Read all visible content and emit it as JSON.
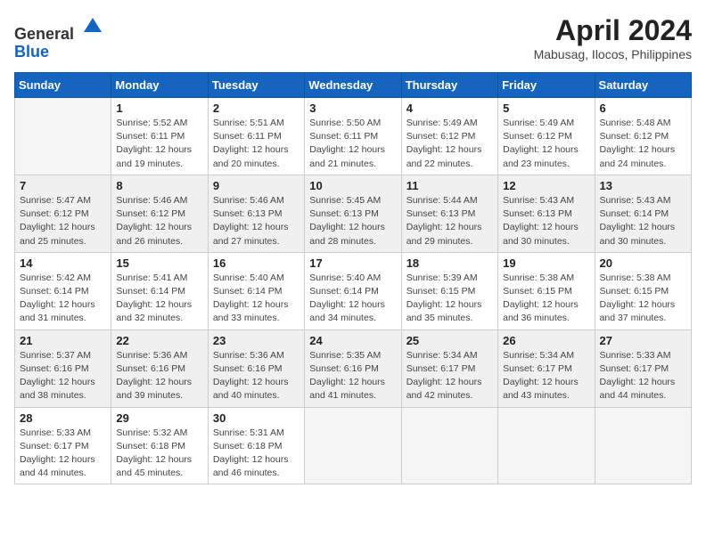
{
  "logo": {
    "line1": "General",
    "line2": "Blue"
  },
  "title": "April 2024",
  "location": "Mabusag, Ilocos, Philippines",
  "weekdays": [
    "Sunday",
    "Monday",
    "Tuesday",
    "Wednesday",
    "Thursday",
    "Friday",
    "Saturday"
  ],
  "weeks": [
    [
      {
        "day": null
      },
      {
        "day": "1",
        "sunrise": "5:52 AM",
        "sunset": "6:11 PM",
        "daylight": "12 hours and 19 minutes."
      },
      {
        "day": "2",
        "sunrise": "5:51 AM",
        "sunset": "6:11 PM",
        "daylight": "12 hours and 20 minutes."
      },
      {
        "day": "3",
        "sunrise": "5:50 AM",
        "sunset": "6:11 PM",
        "daylight": "12 hours and 21 minutes."
      },
      {
        "day": "4",
        "sunrise": "5:49 AM",
        "sunset": "6:12 PM",
        "daylight": "12 hours and 22 minutes."
      },
      {
        "day": "5",
        "sunrise": "5:49 AM",
        "sunset": "6:12 PM",
        "daylight": "12 hours and 23 minutes."
      },
      {
        "day": "6",
        "sunrise": "5:48 AM",
        "sunset": "6:12 PM",
        "daylight": "12 hours and 24 minutes."
      }
    ],
    [
      {
        "day": "7",
        "sunrise": "5:47 AM",
        "sunset": "6:12 PM",
        "daylight": "12 hours and 25 minutes."
      },
      {
        "day": "8",
        "sunrise": "5:46 AM",
        "sunset": "6:12 PM",
        "daylight": "12 hours and 26 minutes."
      },
      {
        "day": "9",
        "sunrise": "5:46 AM",
        "sunset": "6:13 PM",
        "daylight": "12 hours and 27 minutes."
      },
      {
        "day": "10",
        "sunrise": "5:45 AM",
        "sunset": "6:13 PM",
        "daylight": "12 hours and 28 minutes."
      },
      {
        "day": "11",
        "sunrise": "5:44 AM",
        "sunset": "6:13 PM",
        "daylight": "12 hours and 29 minutes."
      },
      {
        "day": "12",
        "sunrise": "5:43 AM",
        "sunset": "6:13 PM",
        "daylight": "12 hours and 30 minutes."
      },
      {
        "day": "13",
        "sunrise": "5:43 AM",
        "sunset": "6:14 PM",
        "daylight": "12 hours and 30 minutes."
      }
    ],
    [
      {
        "day": "14",
        "sunrise": "5:42 AM",
        "sunset": "6:14 PM",
        "daylight": "12 hours and 31 minutes."
      },
      {
        "day": "15",
        "sunrise": "5:41 AM",
        "sunset": "6:14 PM",
        "daylight": "12 hours and 32 minutes."
      },
      {
        "day": "16",
        "sunrise": "5:40 AM",
        "sunset": "6:14 PM",
        "daylight": "12 hours and 33 minutes."
      },
      {
        "day": "17",
        "sunrise": "5:40 AM",
        "sunset": "6:14 PM",
        "daylight": "12 hours and 34 minutes."
      },
      {
        "day": "18",
        "sunrise": "5:39 AM",
        "sunset": "6:15 PM",
        "daylight": "12 hours and 35 minutes."
      },
      {
        "day": "19",
        "sunrise": "5:38 AM",
        "sunset": "6:15 PM",
        "daylight": "12 hours and 36 minutes."
      },
      {
        "day": "20",
        "sunrise": "5:38 AM",
        "sunset": "6:15 PM",
        "daylight": "12 hours and 37 minutes."
      }
    ],
    [
      {
        "day": "21",
        "sunrise": "5:37 AM",
        "sunset": "6:16 PM",
        "daylight": "12 hours and 38 minutes."
      },
      {
        "day": "22",
        "sunrise": "5:36 AM",
        "sunset": "6:16 PM",
        "daylight": "12 hours and 39 minutes."
      },
      {
        "day": "23",
        "sunrise": "5:36 AM",
        "sunset": "6:16 PM",
        "daylight": "12 hours and 40 minutes."
      },
      {
        "day": "24",
        "sunrise": "5:35 AM",
        "sunset": "6:16 PM",
        "daylight": "12 hours and 41 minutes."
      },
      {
        "day": "25",
        "sunrise": "5:34 AM",
        "sunset": "6:17 PM",
        "daylight": "12 hours and 42 minutes."
      },
      {
        "day": "26",
        "sunrise": "5:34 AM",
        "sunset": "6:17 PM",
        "daylight": "12 hours and 43 minutes."
      },
      {
        "day": "27",
        "sunrise": "5:33 AM",
        "sunset": "6:17 PM",
        "daylight": "12 hours and 44 minutes."
      }
    ],
    [
      {
        "day": "28",
        "sunrise": "5:33 AM",
        "sunset": "6:17 PM",
        "daylight": "12 hours and 44 minutes."
      },
      {
        "day": "29",
        "sunrise": "5:32 AM",
        "sunset": "6:18 PM",
        "daylight": "12 hours and 45 minutes."
      },
      {
        "day": "30",
        "sunrise": "5:31 AM",
        "sunset": "6:18 PM",
        "daylight": "12 hours and 46 minutes."
      },
      {
        "day": null
      },
      {
        "day": null
      },
      {
        "day": null
      },
      {
        "day": null
      }
    ]
  ]
}
